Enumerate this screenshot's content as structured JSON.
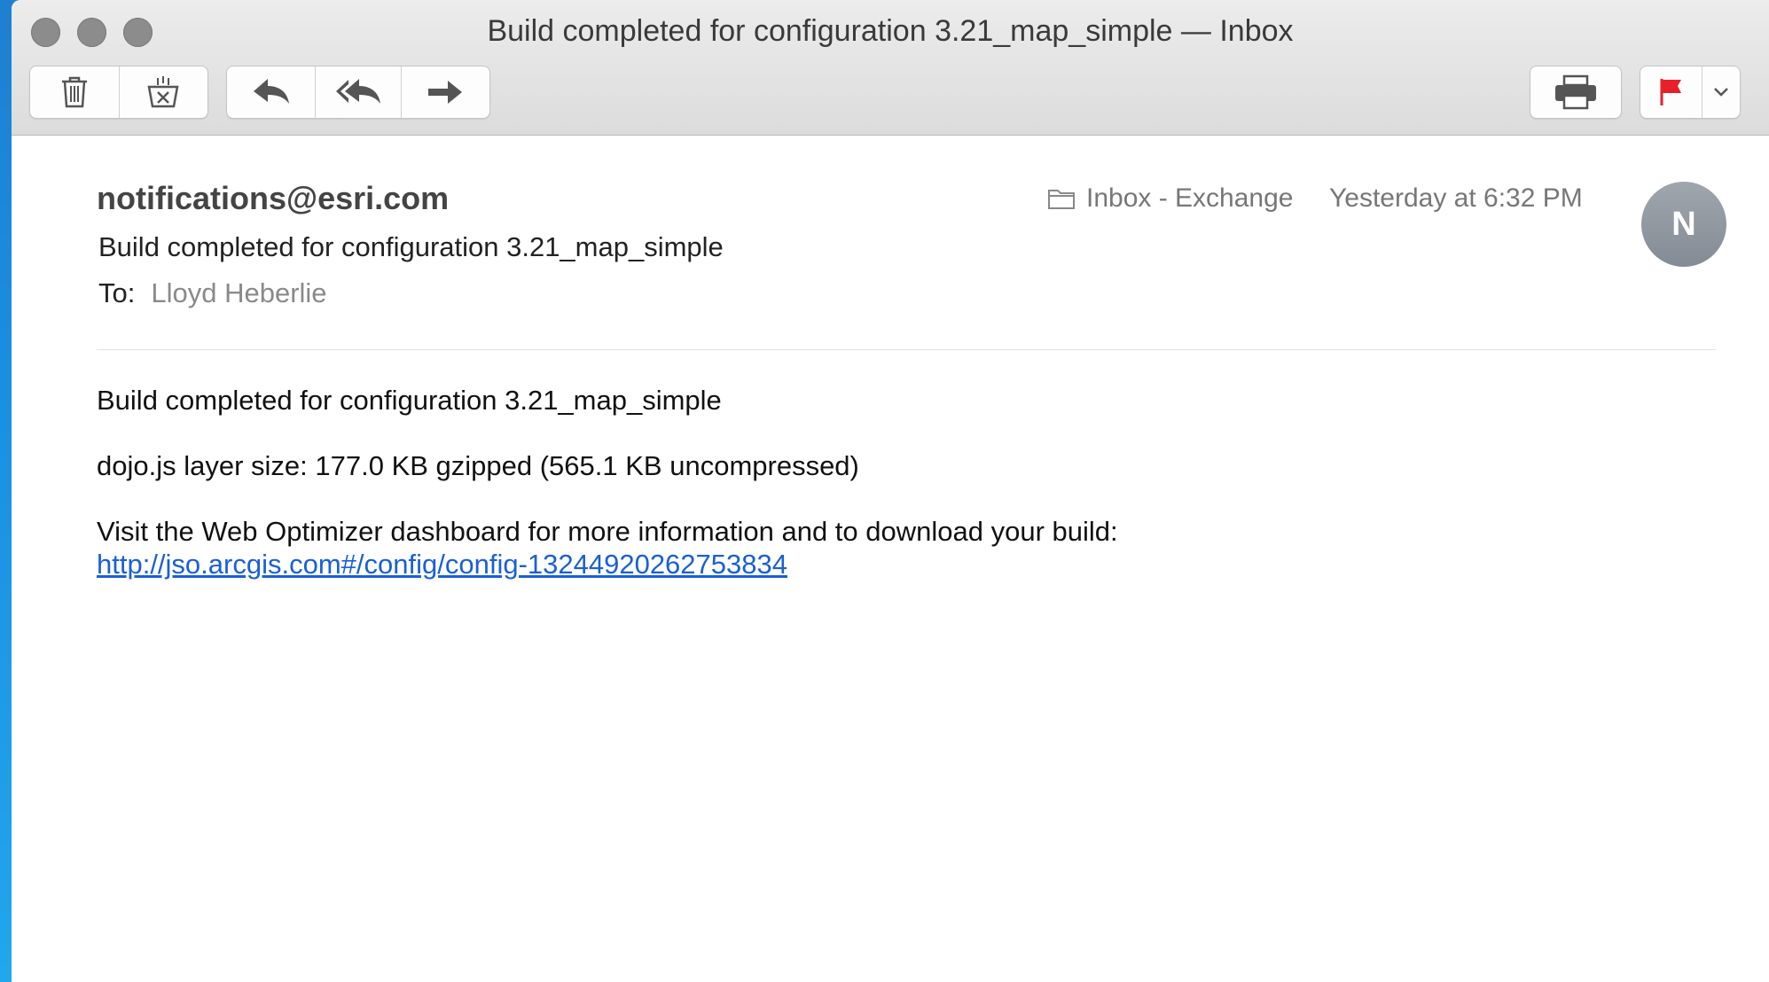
{
  "window": {
    "title": "Build completed for configuration 3.21_map_simple — Inbox"
  },
  "toolbar": {
    "buttons": [
      {
        "name": "delete",
        "icon": "trash-icon"
      },
      {
        "name": "junk",
        "icon": "junk-icon"
      },
      {
        "name": "reply",
        "icon": "reply-icon"
      },
      {
        "name": "reply-all",
        "icon": "reply-all-icon"
      },
      {
        "name": "forward",
        "icon": "forward-icon"
      },
      {
        "name": "print",
        "icon": "printer-icon"
      },
      {
        "name": "flag",
        "icon": "flag-icon",
        "color": "#e8202a"
      },
      {
        "name": "flag-menu",
        "icon": "chevron-down-icon"
      }
    ]
  },
  "message": {
    "from": "notifications@esri.com",
    "subject": "Build completed for configuration 3.21_map_simple",
    "to_label": "To:",
    "to_value": "Lloyd Heberlie",
    "mailbox": "Inbox - Exchange",
    "date": "Yesterday at 6:32 PM",
    "avatar_initial": "N",
    "body": {
      "line1": "Build completed for configuration 3.21_map_simple",
      "line2": "dojo.js layer size: 177.0 KB gzipped (565.1 KB uncompressed)",
      "line3": "Visit the Web Optimizer dashboard for more information and to download your build:",
      "link": "http://jso.arcgis.com#/config/config-13244920262753834"
    }
  },
  "colors": {
    "link": "#1a5fd6",
    "flag": "#e8202a",
    "desktop": "#1a8fe0"
  }
}
